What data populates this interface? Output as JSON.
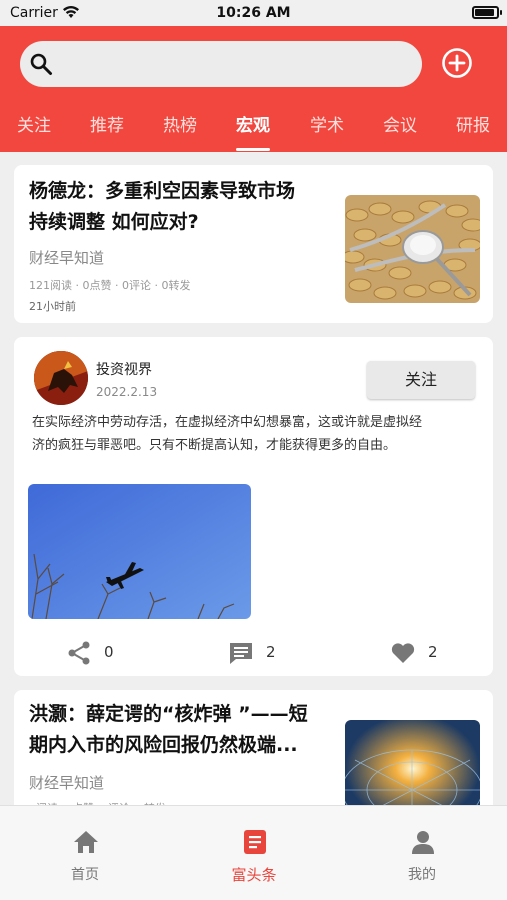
{
  "status_bar": {
    "carrier": "Carrier",
    "time": "10:26 AM"
  },
  "search": {
    "placeholder": ""
  },
  "tabs": [
    {
      "label": "关注"
    },
    {
      "label": "推荐"
    },
    {
      "label": "热榜"
    },
    {
      "label": "宏观",
      "active": true
    },
    {
      "label": "学术"
    },
    {
      "label": "会议"
    },
    {
      "label": "研报"
    }
  ],
  "articles": [
    {
      "title_line1": "杨德龙：多重利空因素导致市场",
      "title_line2": "持续调整 如何应对?",
      "source": "财经早知道",
      "stats": "121阅读 · 0点赞 · 0评论 · 0转发",
      "time": "21小时前"
    },
    {
      "title_line1": "洪灏：薛定谔的“核炸弹 ”——短",
      "title_line2": "期内入市的风险回报仍然极端...",
      "source": "财经早知道",
      "stats": "··阅读 · ·点赞 · ·评论 · ·转发"
    }
  ],
  "post": {
    "author": "投资视界",
    "date": "2022.2.13",
    "follow_label": "关注",
    "body_line1": "在实际经济中劳动存活，在虚拟经济中幻想暴富，这或许就是虚拟经",
    "body_line2": "济的疯狂与罪恶吧。只有不断提高认知，才能获得更多的自由。",
    "share_count": "0",
    "comment_count": "2",
    "like_count": "2"
  },
  "bottom_nav": [
    {
      "label": "首页",
      "icon": "home-icon"
    },
    {
      "label": "富头条",
      "icon": "news-icon",
      "active": true
    },
    {
      "label": "我的",
      "icon": "person-icon"
    }
  ],
  "colors": {
    "brand": "#f1473f",
    "active_nav": "#e8453c"
  }
}
